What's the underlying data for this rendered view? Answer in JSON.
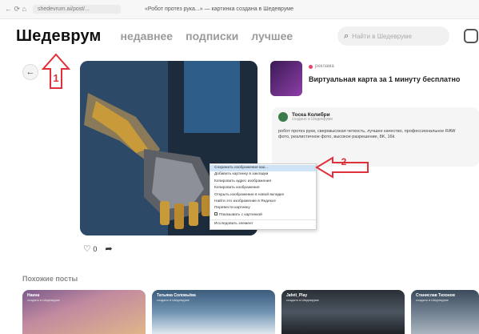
{
  "browser": {
    "nav_icons": "← ⟳ ⌂",
    "url": "shedevrum.ai/post/...",
    "title": "«Робот протез рука...» — картинка создана в Шедевруме"
  },
  "header": {
    "logo": "Шедеврум",
    "nav": [
      "недавнее",
      "подписки",
      "лучшее"
    ],
    "search_placeholder": "Найти в Шедевруме"
  },
  "annotations": {
    "label_1": "1",
    "label_2": "2",
    "color": "#e0303a"
  },
  "post": {
    "likes": "0"
  },
  "ad": {
    "source": "реклама",
    "title": "Виртуальная карта за 1 минуту бесплатно"
  },
  "author": {
    "name": "Тоска Колибри",
    "subtitle": "создано в Шедевруме",
    "prompt": "робот протез руки, сверхвысокая четкость, лучшее качество, профессиональное RAW фото, реалистичное фото, высокое разрешение, 8K, 16k"
  },
  "context_menu": {
    "items": [
      "Сохранить изображение как...",
      "Добавить картинку в закладки",
      "Копировать адрес изображения",
      "Копировать изображение",
      "Открыть изображение в новой вкладке",
      "Найти это изображение в Яндексе",
      "Перевести картинку",
      "Показывать с картинкой",
      "Исследовать элемент"
    ]
  },
  "similar": {
    "title": "Похожие посты",
    "posts": [
      {
        "author": "Наина",
        "sub": "создано в Шедевруме"
      },
      {
        "author": "Татьяна Соловьёва",
        "sub": "создано в Шедевруме"
      },
      {
        "author": "Jafeti_Play",
        "sub": "создано в Шедевруме"
      },
      {
        "author": "Станислав Тихонов",
        "sub": "создано в Шедевруме"
      }
    ]
  }
}
